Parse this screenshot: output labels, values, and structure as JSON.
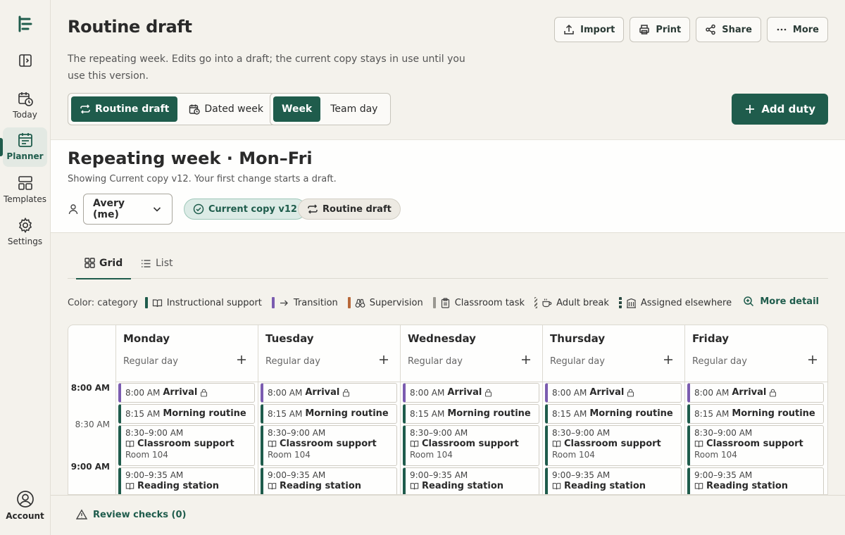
{
  "sidebar": {
    "items": [
      {
        "label": "Today",
        "icon": "clock-calendar-icon"
      },
      {
        "label": "Planner",
        "icon": "planner-icon",
        "active": true
      },
      {
        "label": "Templates",
        "icon": "templates-icon"
      },
      {
        "label": "Settings",
        "icon": "gear-icon"
      }
    ],
    "account_label": "Account"
  },
  "header": {
    "title": "Routine draft",
    "description": "The repeating week. Edits go into a draft; the current copy stays in use until you use this version.",
    "actions": {
      "import": "Import",
      "print": "Print",
      "share": "Share",
      "more": "More"
    }
  },
  "mode_toggle": {
    "routine": "Routine draft",
    "dated": "Dated week",
    "selected": "Routine draft"
  },
  "view_toggle": {
    "week": "Week",
    "team": "Team day",
    "selected": "Week"
  },
  "add_duty_label": "Add duty",
  "panel": {
    "title": "Repeating week · Mon–Fri",
    "subtitle": "Showing Current copy v12. Your first change starts a draft.",
    "person": "Avery (me)",
    "chip_current": "Current copy v12",
    "chip_draft": "Routine draft"
  },
  "tabs": {
    "grid": "Grid",
    "list": "List",
    "selected": "Grid"
  },
  "legend": {
    "title": "Color: category",
    "items": [
      {
        "label": "Instructional support",
        "color": "#1f5c4c",
        "icon": "book-icon"
      },
      {
        "label": "Transition",
        "color": "#7b5cb0",
        "icon": "arrow-right-icon"
      },
      {
        "label": "Supervision",
        "color": "#b8693a",
        "icon": "binoculars-icon"
      },
      {
        "label": "Classroom task",
        "color": "#9a9891",
        "icon": "clipboard-icon"
      },
      {
        "label": "Adult break",
        "color": "#6b6962",
        "icon": "coffee-icon"
      },
      {
        "label": "Assigned elsewhere",
        "color": "#2a4a42",
        "icon": "building-icon"
      }
    ],
    "more_detail": "More detail"
  },
  "grid": {
    "times": [
      "8:00 AM",
      "8:30 AM",
      "9:00 AM"
    ],
    "days": [
      {
        "name": "Monday",
        "type": "Regular day"
      },
      {
        "name": "Tuesday",
        "type": "Regular day"
      },
      {
        "name": "Wednesday",
        "type": "Regular day"
      },
      {
        "name": "Thursday",
        "type": "Regular day"
      },
      {
        "name": "Friday",
        "type": "Regular day"
      }
    ],
    "duties": [
      {
        "time": "8:00 AM",
        "name": "Arrival",
        "category": "Transition",
        "locked": true
      },
      {
        "time": "8:15 AM",
        "name": "Morning routine",
        "category": "Instructional support"
      },
      {
        "time": "8:30–9:00 AM",
        "name": "Classroom support",
        "room": "Room 104",
        "category": "Instructional support"
      },
      {
        "time": "9:00–9:35 AM",
        "name": "Reading station",
        "category": "Instructional support"
      }
    ]
  },
  "footer": {
    "review": "Review checks (0)"
  },
  "colors": {
    "accent": "#1f5c4c",
    "transition": "#7b5cb0"
  }
}
